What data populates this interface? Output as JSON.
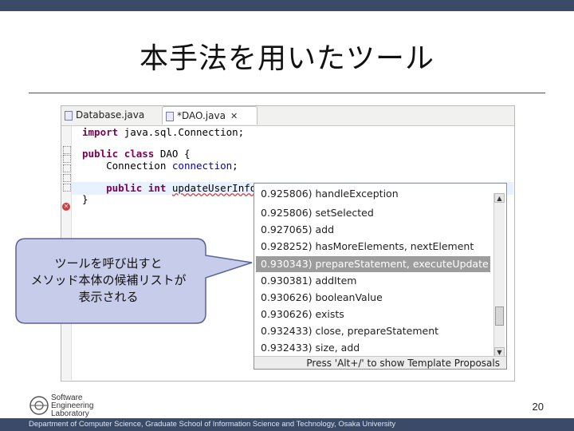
{
  "slide": {
    "title": "本手法を用いたツール",
    "page_number": "20",
    "footer": "Department of Computer Science, Graduate School of Information Science and Technology, Osaka University",
    "logo": {
      "line1": "Software",
      "line2": "Engineering",
      "line3": "Laboratory"
    }
  },
  "editor": {
    "tabs": [
      {
        "label": "Database.java"
      },
      {
        "label": "*DAO.java",
        "close": "✕"
      }
    ],
    "code": {
      "line1": {
        "kw": "import",
        "rest": " java.sql.Connection;"
      },
      "line2": {
        "kw1": "public",
        "kw2": "class",
        "rest": " DAO {"
      },
      "line3": {
        "type": "    Connection ",
        "field": "connection",
        "end": ";"
      },
      "line4": {
        "kw1": "public",
        "kw2": "int",
        "method": "updateUserInfo"
      },
      "line5": {
        "text": "}"
      }
    }
  },
  "completion": {
    "items": [
      "0.925806) handleException",
      "0.925806) setSelected",
      "0.927065) add",
      "0.928252) hasMoreElements, nextElement",
      "0.930343) prepareStatement, executeUpdate",
      "0.930381) addItem",
      "0.930626) booleanValue",
      "0.930626) exists",
      "0.932433) close, prepareStatement",
      "0.932433) size, add"
    ],
    "selected_index": 4,
    "footer": "Press 'Alt+/' to show Template Proposals",
    "scroll_up": "▲",
    "scroll_down": "▼"
  },
  "callout": {
    "line1": "ツールを呼び出すと",
    "line2": "メソッド本体の候補リストが",
    "line3": "表示される",
    "fill_color": "#c6ccea",
    "stroke_color": "#5a6394"
  },
  "colors": {
    "topbar": "#3b4a66",
    "keyword": "#7f0055",
    "field": "#0000c0",
    "selection": "#9c9c9c"
  }
}
